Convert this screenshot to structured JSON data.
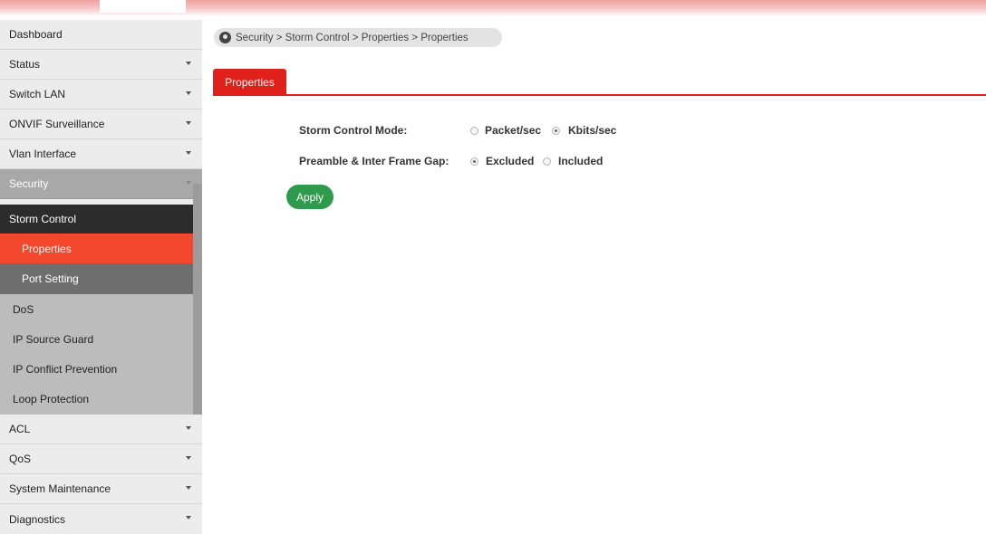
{
  "sidebar": {
    "items": [
      {
        "label": "Dashboard"
      },
      {
        "label": "Status"
      },
      {
        "label": "Switch LAN"
      },
      {
        "label": "ONVIF Surveillance"
      },
      {
        "label": "Vlan Interface"
      },
      {
        "label": "Security"
      },
      {
        "label": "ACL"
      },
      {
        "label": "QoS"
      },
      {
        "label": "System Maintenance"
      },
      {
        "label": "Diagnostics"
      }
    ],
    "security_sub": {
      "storm_control": "Storm Control",
      "properties": "Properties",
      "port_setting": "Port Setting",
      "dos": "DoS",
      "ip_source_guard": "IP Source Guard",
      "ip_conflict_prevention": "IP Conflict Prevention",
      "loop_protection": "Loop Protection"
    }
  },
  "breadcrumb": {
    "text": "Security > Storm Control > Properties > Properties"
  },
  "tab": {
    "label": "Properties"
  },
  "form": {
    "storm_mode": {
      "label": "Storm Control Mode:",
      "options": [
        "Packet/sec",
        "Kbits/sec"
      ],
      "selected": "Kbits/sec"
    },
    "preamble": {
      "label": "Preamble & Inter Frame Gap:",
      "options": [
        "Excluded",
        "Included"
      ],
      "selected": "Excluded"
    }
  },
  "apply_label": "Apply",
  "colors": {
    "accent_red": "#e0201a",
    "active_item": "#f4482e",
    "apply_green": "#2e9a4c"
  }
}
